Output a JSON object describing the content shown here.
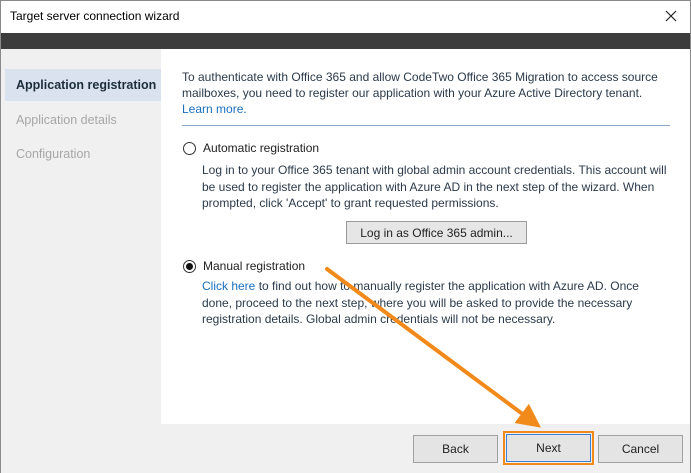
{
  "window": {
    "title": "Target server connection wizard"
  },
  "sidebar": {
    "items": [
      {
        "label": "Application registration",
        "state": "active"
      },
      {
        "label": "Application details",
        "state": "disabled"
      },
      {
        "label": "Configuration",
        "state": "disabled"
      }
    ]
  },
  "intro": {
    "text": "To authenticate with Office 365 and allow CodeTwo Office 365 Migration to access source mailboxes, you need to register our application with your Azure Active Directory tenant.",
    "link": "Learn more."
  },
  "options": {
    "automatic": {
      "label": "Automatic registration",
      "selected": false,
      "description": "Log in to your Office 365 tenant with global admin account credentials. This account will be used to register the application with Azure AD in the next step of the wizard. When prompted, click 'Accept' to grant requested permissions.",
      "button": "Log in as Office 365 admin..."
    },
    "manual": {
      "label": "Manual registration",
      "selected": true,
      "link": "Click here",
      "description": "to find out how to manually register the application with Azure AD. Once done, proceed to the next step, where you will be asked to provide the necessary registration details. Global admin credentials will not be necessary."
    }
  },
  "footer": {
    "back": "Back",
    "next": "Next",
    "cancel": "Cancel"
  },
  "colors": {
    "highlight": "#f28a1b",
    "accent_link": "#1a6fbf",
    "sidebar_active_bg": "#d9e2ee"
  }
}
